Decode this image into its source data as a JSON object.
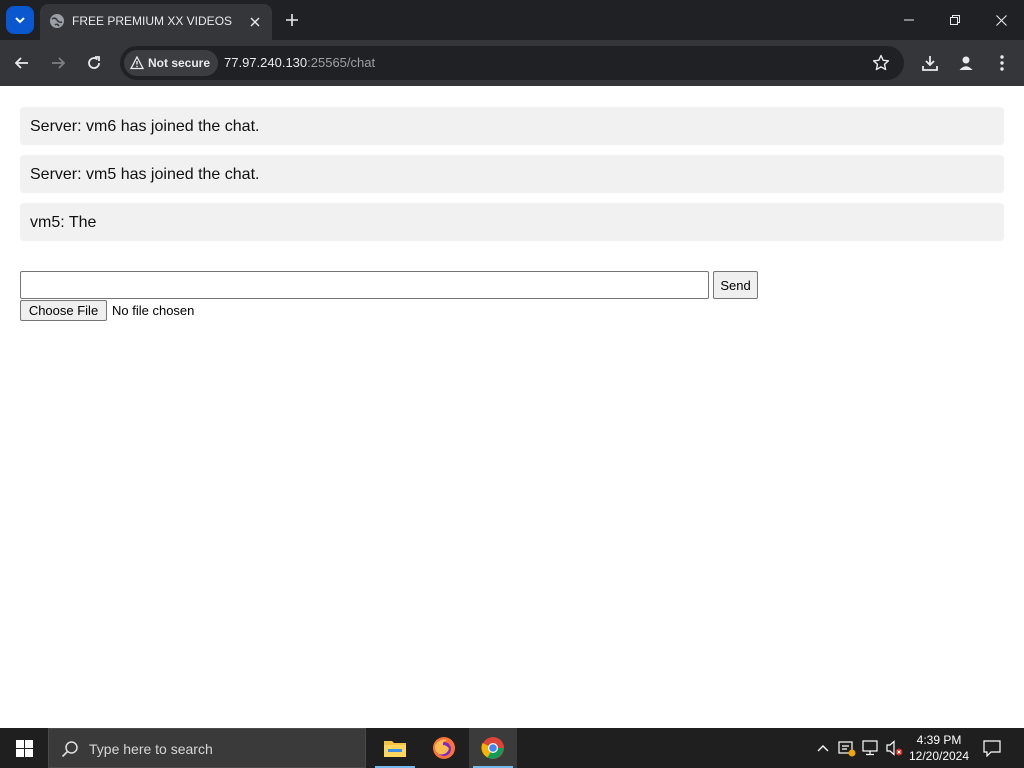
{
  "browser": {
    "tab_title": "FREE PREMIUM XX VIDEOS",
    "security_label": "Not secure",
    "url_host": "77.97.240.130",
    "url_rest": ":25565/chat"
  },
  "chat": {
    "messages": [
      {
        "text": "Server: vm6 has joined the chat."
      },
      {
        "text": "Server: vm5 has joined the chat."
      },
      {
        "text": "vm5: The"
      }
    ],
    "input_value": "",
    "send_label": "Send",
    "file_button_label": "Choose File",
    "file_status": "No file chosen"
  },
  "taskbar": {
    "search_placeholder": "Type here to search",
    "time": "4:39 PM",
    "date": "12/20/2024",
    "apps": [
      "file-explorer",
      "firefox",
      "chrome"
    ]
  },
  "colors": {
    "tab_strip": "#202124",
    "toolbar": "#35363a",
    "message_bg": "#f1f1f1",
    "taskbar": "#1f1f1f"
  }
}
